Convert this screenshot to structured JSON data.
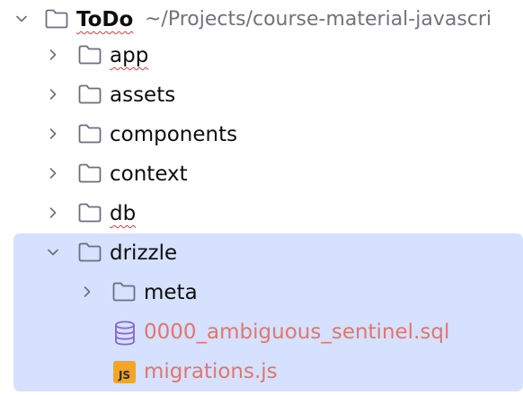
{
  "project": {
    "name": "ToDo",
    "path": "~/Projects/course-material-javascri"
  },
  "folders": {
    "app": "app",
    "assets": "assets",
    "components": "components",
    "context": "context",
    "db": "db",
    "drizzle": "drizzle",
    "meta": "meta"
  },
  "files": {
    "sql": "0000_ambiguous_sentinel.sql",
    "js": "migrations.js"
  },
  "icons": {
    "expanded": "chevron-down-icon",
    "collapsed": "chevron-right-icon",
    "folder": "folder-icon",
    "database": "database-icon",
    "javascript": "js-file-icon",
    "js_badge_text": "JS"
  },
  "colors": {
    "selection": "#d5e1ff",
    "unversioned_file": "#e07670",
    "db_icon": "#8a63d2",
    "js_badge": "#f4a623",
    "path_text": "#6f737a"
  }
}
